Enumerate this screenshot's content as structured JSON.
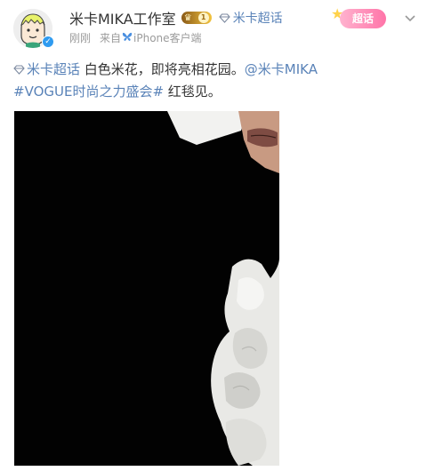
{
  "author": {
    "name": "米卡MIKA工作室",
    "member_level": "1",
    "super_topic": "米卡超话",
    "time": "刚刚",
    "source_prefix": "来自",
    "source_name": "iPhone客户端"
  },
  "actions": {
    "topic_button_label": "超话"
  },
  "post": {
    "topic_link": "米卡超话",
    "text_1": " 白色米花，即将亮相花园。",
    "mention": "@米卡MIKA",
    "hashtag": "#VOGUE时尚之力盛会#",
    "text_2": " 红毯见。"
  },
  "icons": {
    "verified": "verified-badge-icon",
    "diamond": "diamond-icon",
    "butterfly": "butterfly-icon",
    "chevron": "chevron-down-icon"
  },
  "colors": {
    "link": "#5a83b8",
    "text": "#333333",
    "meta": "#9b9b9b",
    "topic_pill": "#ff74a8"
  }
}
